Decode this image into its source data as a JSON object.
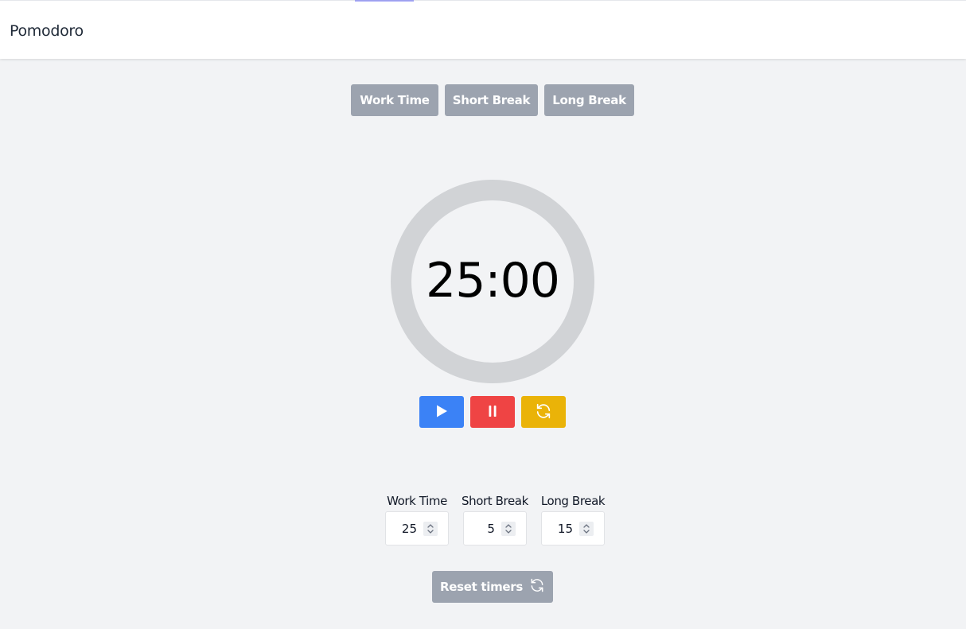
{
  "app": {
    "title": "Pomodoro"
  },
  "modes": [
    {
      "label": "Work Time"
    },
    {
      "label": "Short Break"
    },
    {
      "label": "Long Break"
    }
  ],
  "timer": {
    "display": "25:00",
    "progress": 0
  },
  "controls": {
    "play_icon": "play-icon",
    "pause_icon": "pause-icon",
    "reset_icon": "refresh-icon"
  },
  "settings": [
    {
      "label": "Work Time",
      "value": "25"
    },
    {
      "label": "Short Break",
      "value": "5"
    },
    {
      "label": "Long Break",
      "value": "15"
    }
  ],
  "reset_timers": {
    "label": "Reset timers",
    "icon": "refresh-icon"
  },
  "colors": {
    "play": "#3b82f6",
    "pause": "#ef4444",
    "reset": "#eab308",
    "tab": "#9ca3af",
    "ring": "#d1d3d6"
  }
}
